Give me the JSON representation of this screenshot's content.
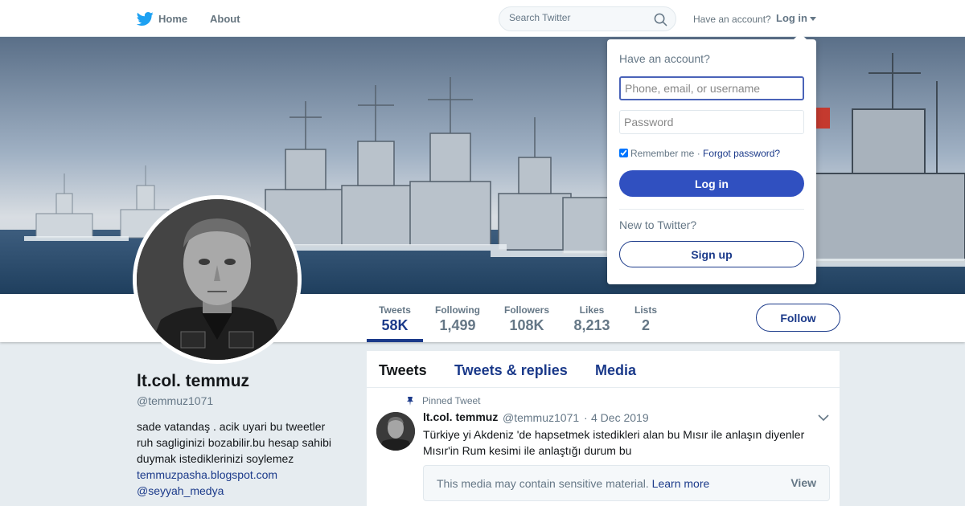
{
  "nav": {
    "home": "Home",
    "about": "About",
    "search_placeholder": "Search Twitter",
    "have_account": "Have an account?",
    "login": "Log in"
  },
  "profile": {
    "name": "lt.col. temmuz",
    "handle": "@temmuz1071",
    "bio": "sade vatandaş . acik uyari bu tweetler ruh sagliginizi bozabilir.bu hesap sahibi duymak istediklerinizi soylemez",
    "links": [
      "temmuzpasha.blogspot.com",
      "@seyyah_medya"
    ],
    "follow": "Follow"
  },
  "stats": [
    {
      "label": "Tweets",
      "value": "58K",
      "active": true
    },
    {
      "label": "Following",
      "value": "1,499"
    },
    {
      "label": "Followers",
      "value": "108K"
    },
    {
      "label": "Likes",
      "value": "8,213"
    },
    {
      "label": "Lists",
      "value": "2"
    }
  ],
  "tabs": [
    "Tweets",
    "Tweets & replies",
    "Media"
  ],
  "tweet": {
    "pinned_label": "Pinned Tweet",
    "name": "lt.col. temmuz",
    "handle": "@temmuz1071",
    "sep": "·",
    "date": "4 Dec 2019",
    "text": "Türkiye yi Akdeniz 'de hapsetmek istedikleri alan bu Mısır ile anlaşın diyenler Mısır'in Rum kesimi ile anlaştığı durum bu",
    "media_warning": "This media may contain sensitive material.",
    "learn_more": "Learn more",
    "view": "View"
  },
  "login_dropdown": {
    "title": "Have an account?",
    "username_placeholder": "Phone, email, or username",
    "password_placeholder": "Password",
    "remember": "Remember me",
    "sep": "·",
    "forgot": "Forgot password?",
    "login_button": "Log in",
    "new_to": "New to Twitter?",
    "signup": "Sign up"
  },
  "colors": {
    "brand_blue": "#1da1f2",
    "link_blue": "#1b3a8a",
    "login_button": "#3050c0"
  },
  "icons": [
    "twitter-bird-icon",
    "search-icon",
    "caret-down-icon",
    "pin-icon",
    "chevron-down-icon"
  ]
}
